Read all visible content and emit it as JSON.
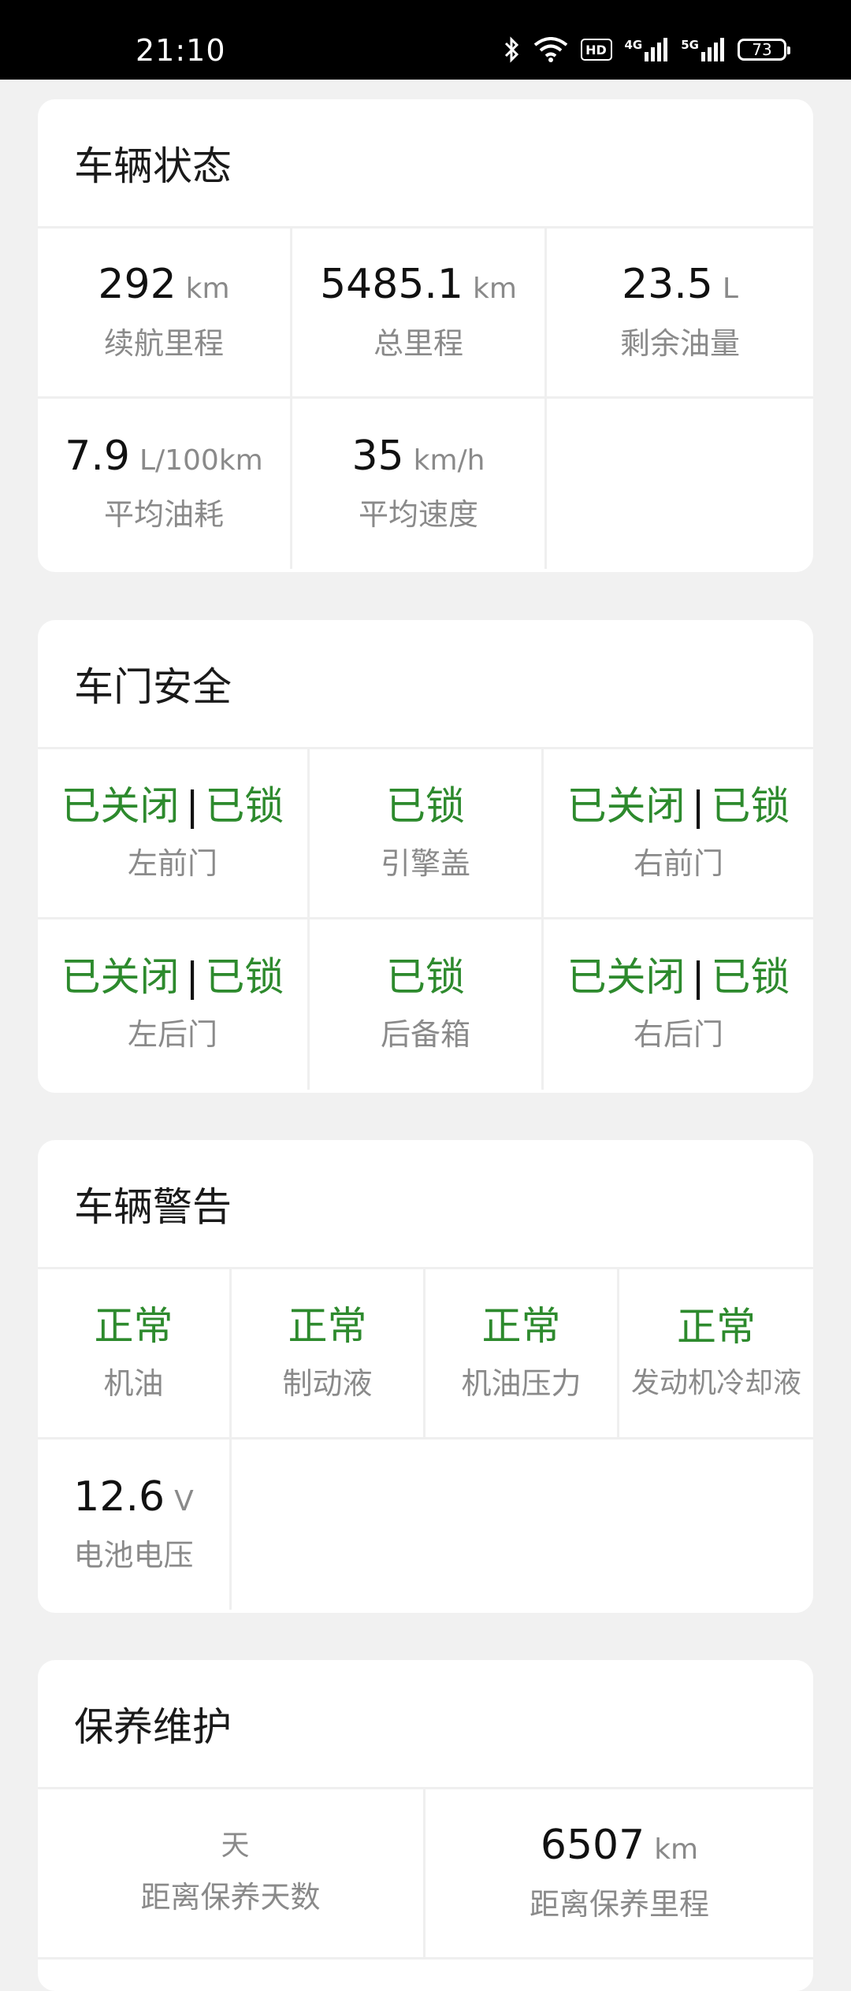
{
  "status_bar": {
    "time": "21:10",
    "hd_label": "HD",
    "net1": "4G",
    "net2": "5G",
    "battery": "73"
  },
  "vehicle_status": {
    "title": "车辆状态",
    "items": [
      {
        "value": "292",
        "unit": "km",
        "label": "续航里程"
      },
      {
        "value": "5485.1",
        "unit": "km",
        "label": "总里程"
      },
      {
        "value": "23.5",
        "unit": "L",
        "label": "剩余油量"
      },
      {
        "value": "7.9",
        "unit": "L/100km",
        "label": "平均油耗"
      },
      {
        "value": "35",
        "unit": "km/h",
        "label": "平均速度"
      }
    ]
  },
  "door_security": {
    "title": "车门安全",
    "items": [
      {
        "status1": "已关闭",
        "sep": "|",
        "status2": "已锁",
        "label": "左前门"
      },
      {
        "status1": "",
        "sep": "",
        "status2": "已锁",
        "label": "引擎盖"
      },
      {
        "status1": "已关闭",
        "sep": "|",
        "status2": "已锁",
        "label": "右前门"
      },
      {
        "status1": "已关闭",
        "sep": "|",
        "status2": "已锁",
        "label": "左后门"
      },
      {
        "status1": "",
        "sep": "",
        "status2": "已锁",
        "label": "后备箱"
      },
      {
        "status1": "已关闭",
        "sep": "|",
        "status2": "已锁",
        "label": "右后门"
      }
    ]
  },
  "vehicle_warning": {
    "title": "车辆警告",
    "items": [
      {
        "status": "正常",
        "label": "机油"
      },
      {
        "status": "正常",
        "label": "制动液"
      },
      {
        "status": "正常",
        "label": "机油压力"
      },
      {
        "status": "正常",
        "label": "发动机冷却液"
      }
    ],
    "battery": {
      "value": "12.6",
      "unit": "V",
      "label": "电池电压"
    }
  },
  "maintenance": {
    "title": "保养维护",
    "items": [
      {
        "value": "",
        "unit": "天",
        "label": "距离保养天数"
      },
      {
        "value": "6507",
        "unit": "km",
        "label": "距离保养里程"
      }
    ]
  },
  "colors": {
    "ok_green": "#2d8a2d",
    "background": "#f1f1f1",
    "card": "#ffffff"
  }
}
